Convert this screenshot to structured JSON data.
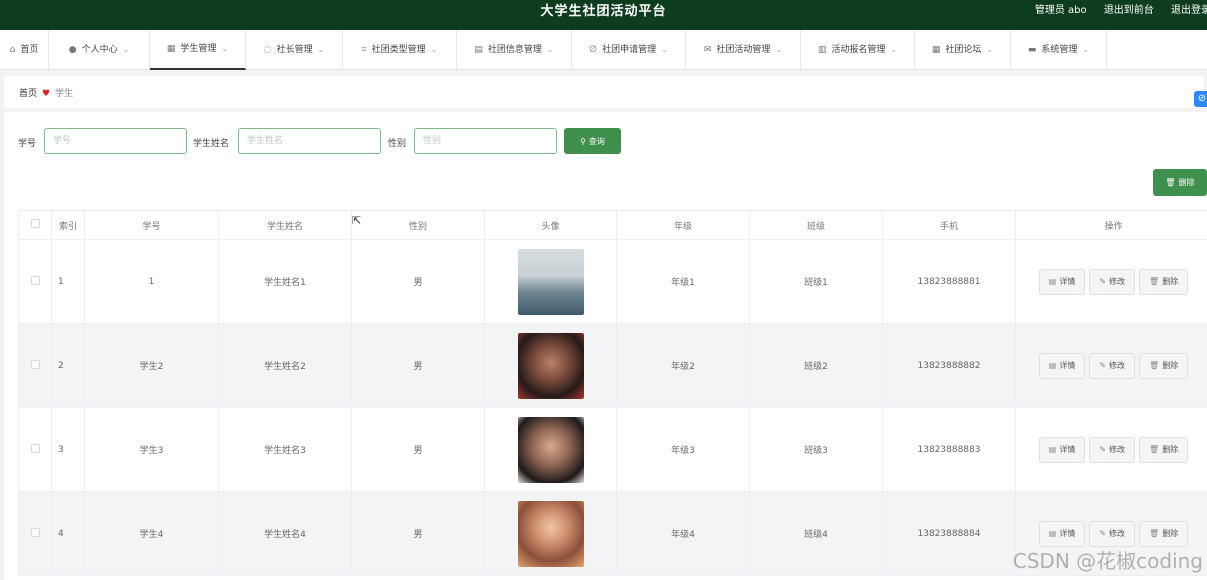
{
  "app": {
    "title": "大学生社团活动平台",
    "user": "管理员 abo",
    "back_front": "退出到前台",
    "logout": "退出登录"
  },
  "nav": [
    {
      "label": "首页",
      "icon": "home-icon",
      "glyph": "⌂",
      "has_menu": false
    },
    {
      "label": "个人中心",
      "icon": "user-icon",
      "glyph": "●",
      "has_menu": true
    },
    {
      "label": "学生管理",
      "icon": "grid-icon",
      "glyph": "▦",
      "has_menu": true
    },
    {
      "label": "社长管理",
      "icon": "power-icon",
      "glyph": "◌",
      "has_menu": true
    },
    {
      "label": "社团类型管理",
      "icon": "crop-icon",
      "glyph": "⌗",
      "has_menu": true
    },
    {
      "label": "社团信息管理",
      "icon": "clipboard-icon",
      "glyph": "▤",
      "has_menu": true
    },
    {
      "label": "社团申请管理",
      "icon": "pencil-icon",
      "glyph": "∅",
      "has_menu": true
    },
    {
      "label": "社团活动管理",
      "icon": "mail-icon",
      "glyph": "✉",
      "has_menu": true
    },
    {
      "label": "活动报名管理",
      "icon": "bar-chart-icon",
      "glyph": "▥",
      "has_menu": true
    },
    {
      "label": "社团论坛",
      "icon": "apps-icon",
      "glyph": "▦",
      "has_menu": true
    },
    {
      "label": "系统管理",
      "icon": "monitor-icon",
      "glyph": "▬",
      "has_menu": true
    }
  ],
  "breadcrumb": {
    "home": "首页",
    "current": "学生"
  },
  "search": {
    "xuehao_label": "学号",
    "xuehao_placeholder": "学号",
    "name_label": "学生姓名",
    "name_placeholder": "学生姓名",
    "gender_label": "性别",
    "gender_placeholder": "性别",
    "query_button": "查询"
  },
  "batch_delete": "删除",
  "table": {
    "headers": [
      "索引",
      "学号",
      "学生姓名",
      "性别",
      "头像",
      "年级",
      "班级",
      "手机",
      "操作"
    ],
    "actions": {
      "detail": "详情",
      "edit": "修改",
      "delete": "删除"
    },
    "rows": [
      {
        "index": "1",
        "xuehao": "1",
        "name": "学生姓名1",
        "gender": "男",
        "grade": "年级1",
        "class": "班级1",
        "phone": "13823888881"
      },
      {
        "index": "2",
        "xuehao": "学生2",
        "name": "学生姓名2",
        "gender": "男",
        "grade": "年级2",
        "class": "班级2",
        "phone": "13823888882"
      },
      {
        "index": "3",
        "xuehao": "学生3",
        "name": "学生姓名3",
        "gender": "男",
        "grade": "年级3",
        "class": "班级3",
        "phone": "13823888883"
      },
      {
        "index": "4",
        "xuehao": "学生4",
        "name": "学生姓名4",
        "gender": "男",
        "grade": "年级4",
        "class": "班级4",
        "phone": "13823888884"
      }
    ]
  },
  "watermark": "CSDN @花椒coding",
  "colors": {
    "topbar": "#0d3c1f",
    "primary_button": "#3f8f4d",
    "heart": "#e01b1b"
  }
}
